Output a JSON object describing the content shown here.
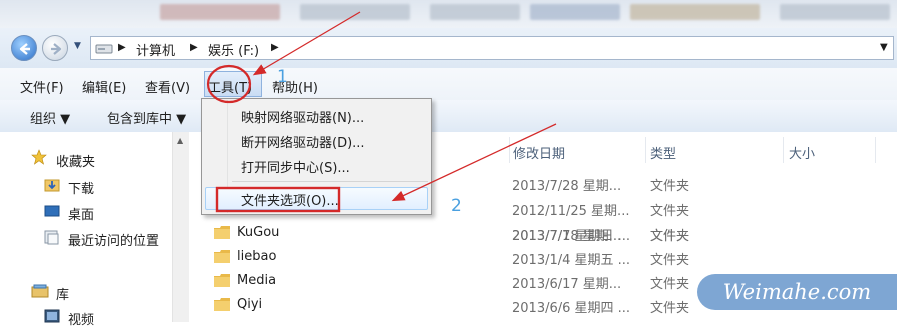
{
  "taskbar": {
    "blurred_items": [
      "",
      "",
      "",
      "",
      "",
      ""
    ]
  },
  "address_bar": {
    "crumbs": [
      "计算机",
      "娱乐 (F:)"
    ],
    "dropdown_glyph": "▼"
  },
  "menubar": {
    "items": [
      {
        "label": "文件(F)"
      },
      {
        "label": "编辑(E)"
      },
      {
        "label": "查看(V)"
      },
      {
        "label": "工具(T)"
      },
      {
        "label": "帮助(H)"
      }
    ]
  },
  "commandbar": {
    "items": [
      {
        "label": "组织 ▼"
      },
      {
        "label": "包含到库中 ▼"
      }
    ]
  },
  "navpane": {
    "favorites_label": "收藏夹",
    "favorites": [
      {
        "label": "下载"
      },
      {
        "label": "桌面"
      },
      {
        "label": "最近访问的位置"
      }
    ],
    "library_label": "库",
    "libraries": [
      {
        "label": "视频"
      }
    ]
  },
  "filelist": {
    "columns": [
      "修改日期",
      "类型",
      "大小"
    ],
    "rows": [
      {
        "name": "",
        "date": "2013/7/28 星期...",
        "type": "文件夹"
      },
      {
        "name": "",
        "date": "2012/11/25 星期...",
        "type": "文件夹"
      },
      {
        "name": "",
        "date": "2013/7/18 星期...",
        "type": "文件夹"
      },
      {
        "name": "KuGou",
        "date": "2013/7/7 星期日 ...",
        "type": "文件夹"
      },
      {
        "name": "liebao",
        "date": "2013/1/4 星期五 ...",
        "type": "文件夹"
      },
      {
        "name": "Media",
        "date": "2013/6/17 星期...",
        "type": "文件夹"
      },
      {
        "name": "Qiyi",
        "date": "2013/6/6 星期四 ...",
        "type": "文件夹"
      }
    ]
  },
  "tools_menu": {
    "items": [
      {
        "label": "映射网络驱动器(N)..."
      },
      {
        "label": "断开网络驱动器(D)..."
      },
      {
        "label": "打开同步中心(S)..."
      }
    ],
    "folder_options": "文件夹选项(O)..."
  },
  "annotations": {
    "step1": "1",
    "step2": "2",
    "accent_color": "#d42a2a",
    "watermark": "Weimahe.com"
  }
}
